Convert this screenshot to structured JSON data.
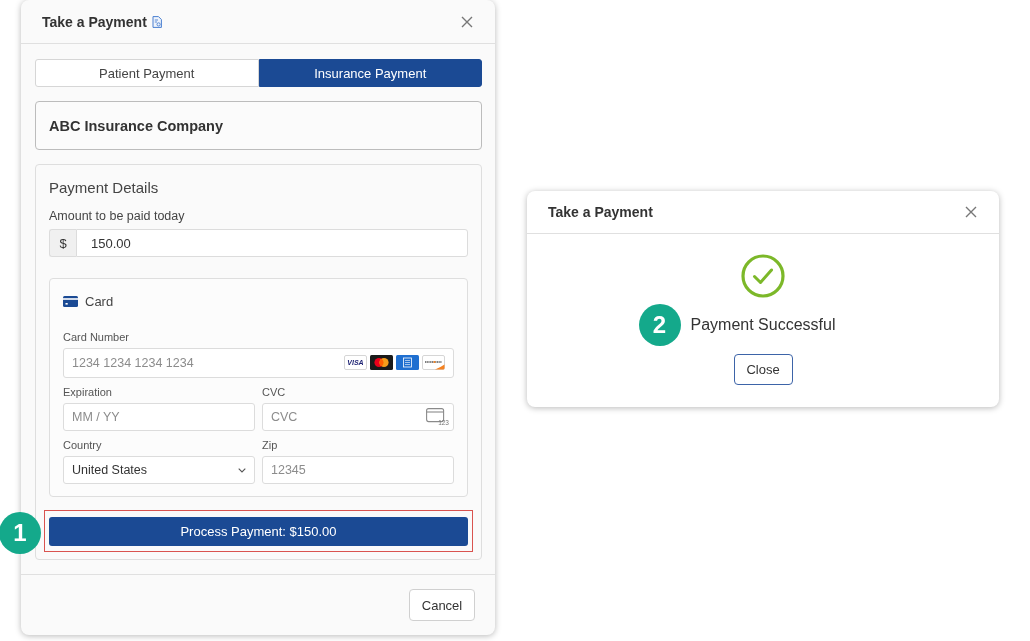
{
  "payment_dialog": {
    "title": "Take a Payment",
    "tabs": [
      {
        "label": "Patient Payment",
        "selected": false
      },
      {
        "label": "Insurance Payment",
        "selected": true
      }
    ],
    "payer": "ABC Insurance Company",
    "payment_details": {
      "heading": "Payment Details",
      "amount": {
        "label": "Amount to be paid today",
        "prefix": "$",
        "value": "150.00"
      },
      "card": {
        "heading": "Card",
        "card_number": {
          "label": "Card Number",
          "placeholder": "1234 1234 1234 1234"
        },
        "card_brands": [
          {
            "kind": "visa",
            "label": "VISA"
          },
          {
            "kind": "mastercard"
          },
          {
            "kind": "amex"
          },
          {
            "kind": "discover"
          }
        ],
        "expiration": {
          "label": "Expiration",
          "placeholder": "MM / YY"
        },
        "cvc": {
          "label": "CVC",
          "placeholder": "CVC",
          "icon_text": "123"
        },
        "country": {
          "label": "Country",
          "value": "United States"
        },
        "zip": {
          "label": "Zip",
          "placeholder": "12345"
        }
      },
      "process_button": {
        "label": "Process Payment: $150.00",
        "highlighted": true,
        "callout": "1"
      }
    },
    "cancel_button": "Cancel"
  },
  "success_dialog": {
    "title": "Take a Payment",
    "message": "Payment Successful",
    "callout": "2",
    "close_button": "Close"
  }
}
